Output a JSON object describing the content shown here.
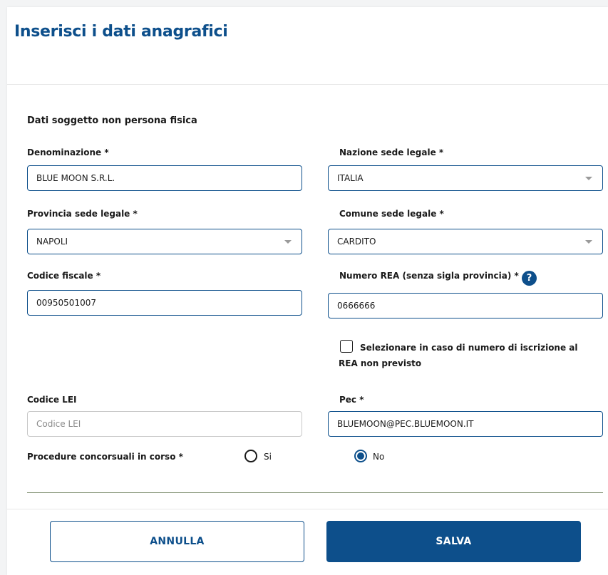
{
  "header": {
    "title": "Inserisci i dati anagrafici"
  },
  "section": {
    "title": "Dati soggetto non persona fisica"
  },
  "fields": {
    "denominazione": {
      "label": "Denominazione *",
      "value": "BLUE MOON S.R.L."
    },
    "nazione": {
      "label": "Nazione sede legale *",
      "value": "ITALIA"
    },
    "provincia": {
      "label": "Provincia sede legale *",
      "value": "NAPOLI"
    },
    "comune": {
      "label": "Comune sede legale *",
      "value": "CARDITO"
    },
    "codice_fiscale": {
      "label": "Codice fiscale *",
      "value": "00950501007"
    },
    "numero_rea": {
      "label": "Numero REA (senza sigla provincia) *",
      "value": "0666666",
      "help_icon": "?"
    },
    "rea_checkbox": {
      "label": "Selezionare in caso di numero di iscrizione al REA non previsto",
      "checked": false
    },
    "codice_lei": {
      "label": "Codice LEI",
      "value": "",
      "placeholder": "Codice LEI"
    },
    "pec": {
      "label": "Pec *",
      "value": "BLUEMOON@PEC.BLUEMOON.IT"
    },
    "procedure": {
      "label": "Procedure concorsuali in corso *",
      "options": [
        {
          "label": "Si",
          "selected": false
        },
        {
          "label": "No",
          "selected": true
        }
      ]
    }
  },
  "actions": {
    "cancel_label": "ANNULLA",
    "save_label": "SALVA"
  },
  "colors": {
    "primary": "#0d4f8b",
    "border_inactive": "#c8c8c8"
  }
}
